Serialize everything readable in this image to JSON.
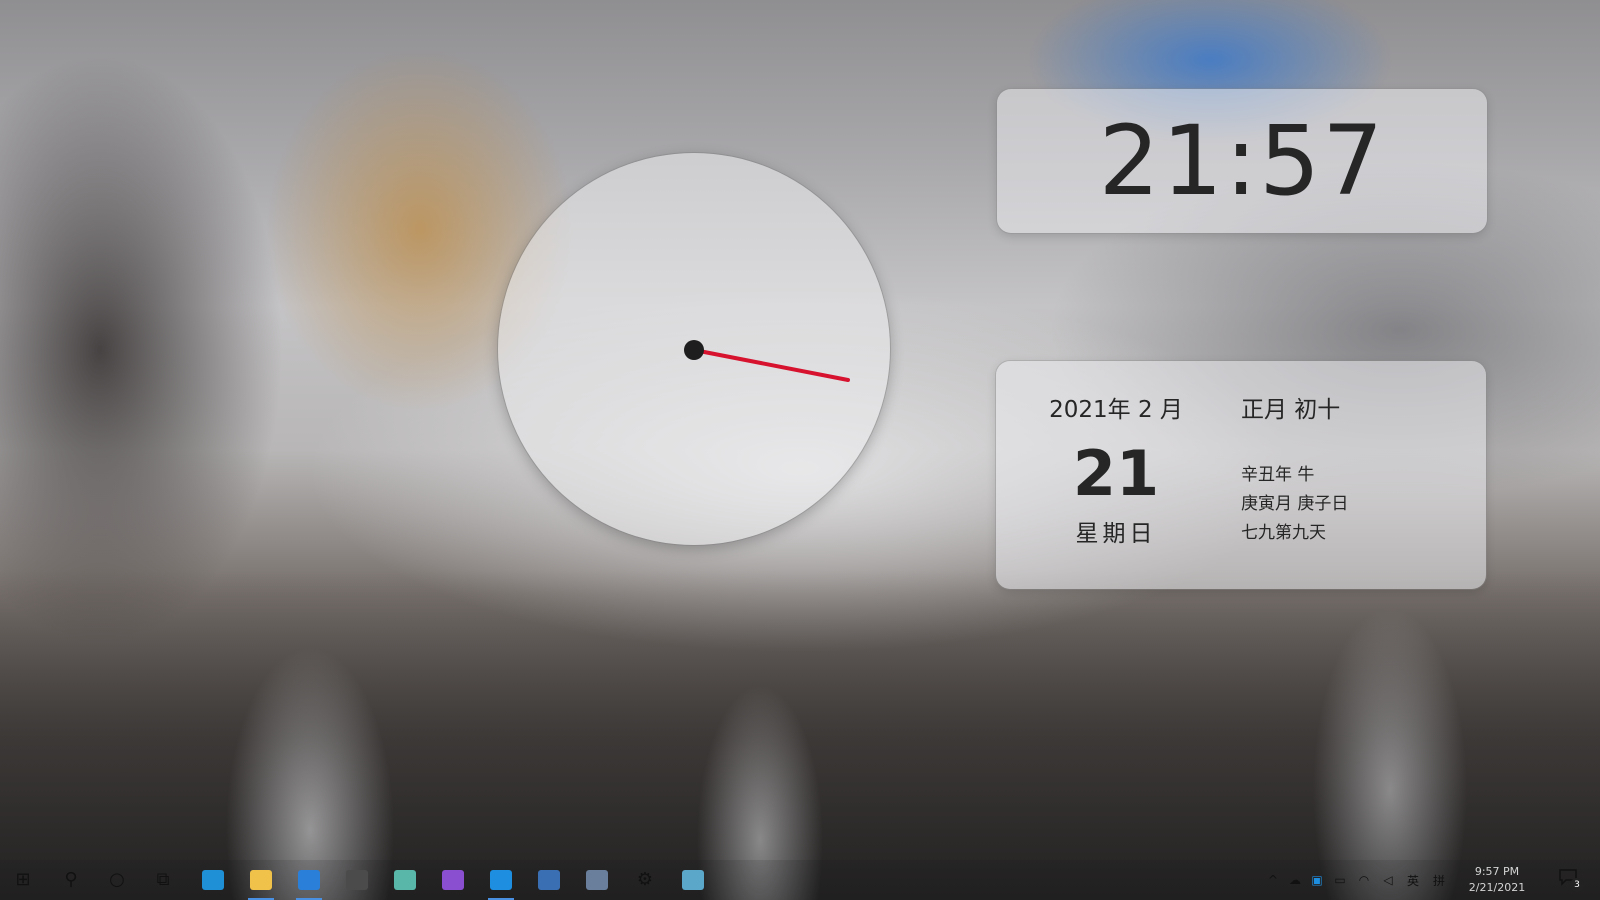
{
  "desktop": {
    "analog_clock": {
      "second_hand_color": "#d6122e",
      "center_dot_color": "#1e1e1e"
    },
    "digital_clock": {
      "time": "21:57"
    },
    "calendar": {
      "year_month": "2021年 2 月",
      "day": "21",
      "weekday": "星期日",
      "lunar_date": "正月 初十",
      "ganzhi_year": "辛丑年 牛",
      "ganzhi_month_day": "庚寅月 庚子日",
      "solar_term": "七九第九天"
    }
  },
  "taskbar": {
    "apps": [
      {
        "name": "start-icon",
        "glyph": "⊞",
        "pinned": true
      },
      {
        "name": "search-icon",
        "glyph": "⚲"
      },
      {
        "name": "cortana-icon",
        "glyph": "○"
      },
      {
        "name": "task-view-icon",
        "glyph": "⧉"
      },
      {
        "name": "edge-icon",
        "color": "#1f8fd6"
      },
      {
        "name": "file-explorer-icon",
        "color": "#f0c24a",
        "running": true
      },
      {
        "name": "edge-dev-icon",
        "color": "#2a7fd8",
        "running": true
      },
      {
        "name": "store-icon",
        "color": "#4b4b4b"
      },
      {
        "name": "app-tile-icon",
        "color": "#58b7a8"
      },
      {
        "name": "visual-studio-icon",
        "color": "#8a4fd1"
      },
      {
        "name": "remote-desktop-icon",
        "color": "#1e8ee0",
        "running": true
      },
      {
        "name": "calendar-app-icon",
        "color": "#3b6fb4"
      },
      {
        "name": "photos-icon",
        "color": "#6a7f9c"
      },
      {
        "name": "settings-icon",
        "glyph": "⚙"
      },
      {
        "name": "app-tile-2-icon",
        "color": "#5aa7c9"
      }
    ],
    "tray": {
      "chevron": "^",
      "language": "英",
      "ime": "拼",
      "time": "9:57 PM",
      "date": "2/21/2021",
      "notification_count": "3"
    }
  }
}
